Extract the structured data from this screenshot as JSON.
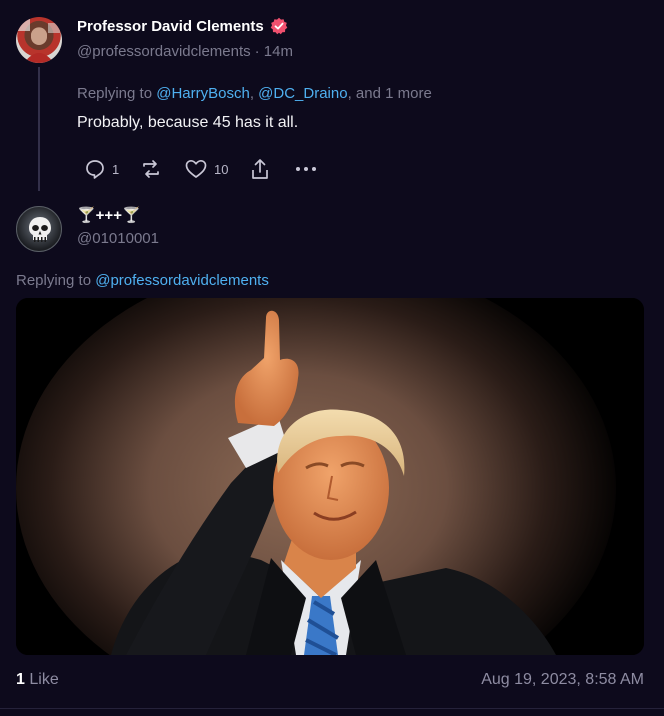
{
  "reply_tweet": {
    "author_name": "Professor David Clements",
    "handle": "@professordavidclements",
    "time": "· 14m",
    "replying_prefix": "Replying to",
    "mention_1": "@HarryBosch",
    "separator_1": ",",
    "mention_2": "@DC_Draino",
    "rest": ", and 1 more",
    "text": "Probably, because 45 has it all.",
    "reply_count": "1",
    "retweet_count": "",
    "like_count": "10"
  },
  "main_tweet": {
    "author_name": "🍸+++🍸",
    "handle": "@01010001",
    "replying_prefix": "Replying to",
    "mention": "@professordavidclements",
    "likes_count": "1",
    "likes_label": "Like",
    "timestamp": "Aug 19, 2023, 8:58 AM"
  },
  "colors": {
    "background": "#0d0a1c",
    "link": "#4fb0f0",
    "verified_badge": "#f0506e",
    "muted": "#7b7a8e"
  },
  "icons": [
    "verified-badge-icon",
    "reply-icon",
    "retweet-icon",
    "like-icon",
    "share-icon",
    "more-icon",
    "punisher-avatar-icon"
  ]
}
